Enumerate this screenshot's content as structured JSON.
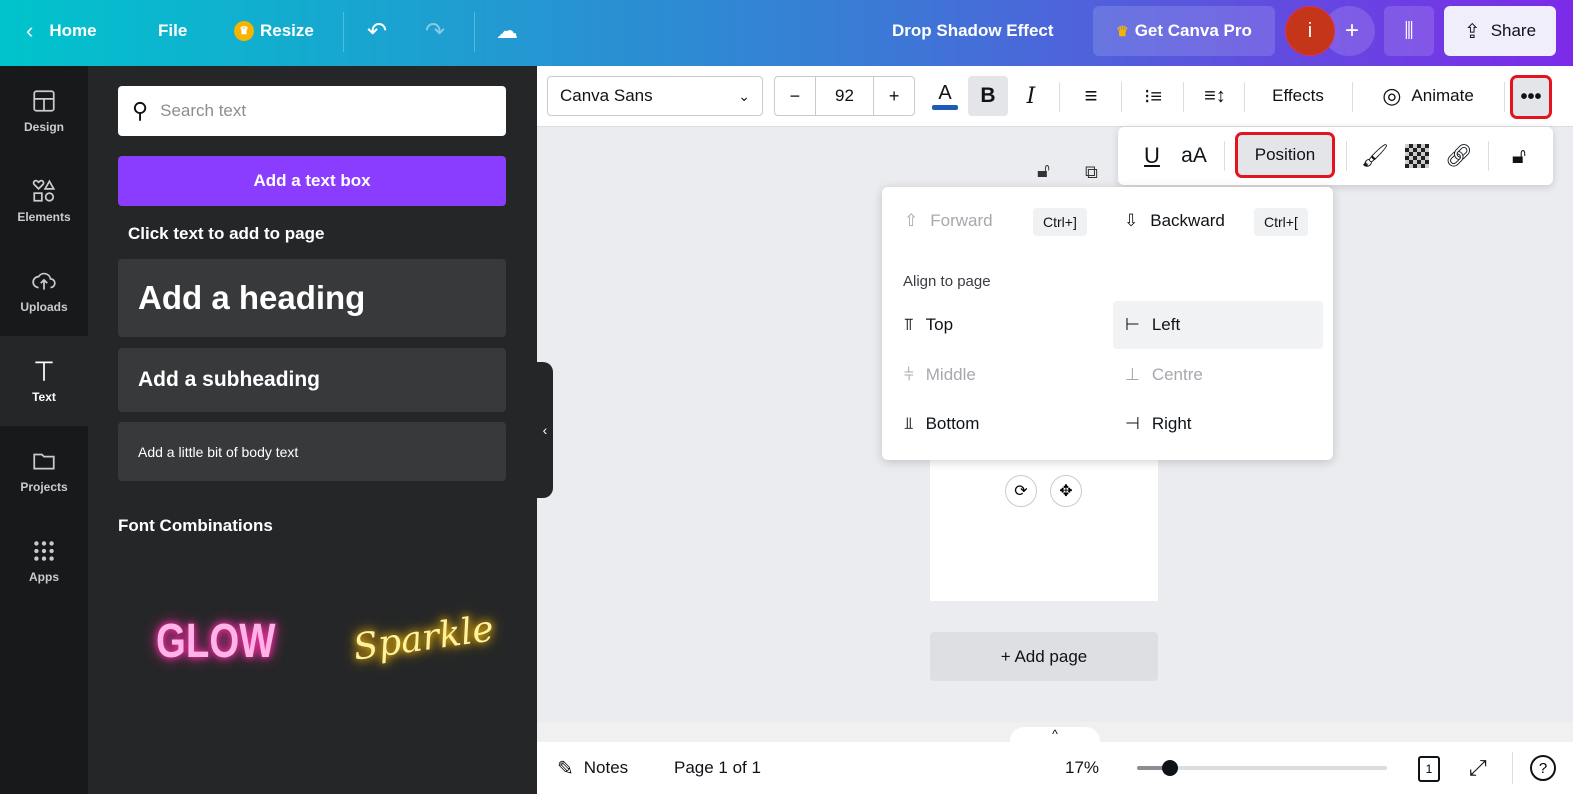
{
  "topbar": {
    "home": "Home",
    "file": "File",
    "resize": "Resize",
    "title": "Drop Shadow Effect",
    "get_pro": "Get Canva Pro",
    "avatar_letter": "i",
    "share": "Share"
  },
  "rail": [
    {
      "label": "Design",
      "icon": "layout-icon"
    },
    {
      "label": "Elements",
      "icon": "shapes-icon"
    },
    {
      "label": "Uploads",
      "icon": "cloud-upload-icon"
    },
    {
      "label": "Text",
      "icon": "text-icon"
    },
    {
      "label": "Projects",
      "icon": "folder-icon"
    },
    {
      "label": "Apps",
      "icon": "grid-icon"
    }
  ],
  "panel": {
    "search_placeholder": "Search text",
    "add_textbox": "Add a text box",
    "click_hint": "Click text to add to page",
    "heading": "Add a heading",
    "subheading": "Add a subheading",
    "body": "Add a little bit of body text",
    "font_combos": "Font Combinations",
    "combo1": "GLOW",
    "combo2": "Sparkle"
  },
  "toolbar": {
    "font": "Canva Sans",
    "font_size": "92",
    "minus": "−",
    "plus": "+",
    "effects": "Effects",
    "animate": "Animate"
  },
  "submenu": {
    "position": "Position",
    "case": "aA"
  },
  "position_menu": {
    "forward": "Forward",
    "forward_kbd": "Ctrl+]",
    "backward": "Backward",
    "backward_kbd": "Ctrl+[",
    "align_title": "Align to page",
    "top": "Top",
    "left": "Left",
    "middle": "Middle",
    "centre": "Centre",
    "bottom": "Bottom",
    "right": "Right"
  },
  "canvas": {
    "add_page": "+ Add page"
  },
  "bottombar": {
    "notes": "Notes",
    "page": "Page 1 of 1",
    "zoom": "17%",
    "zoom_value": 17,
    "page_count": "1"
  },
  "colors": {
    "accent": "#8b3dff",
    "text_color": "#1e5bb8",
    "highlight": "#e3141f"
  }
}
